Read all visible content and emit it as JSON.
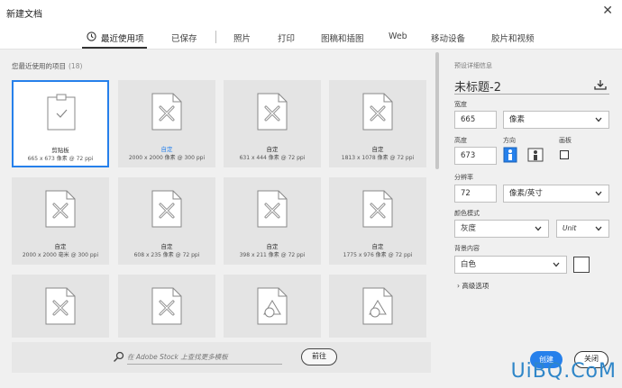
{
  "window": {
    "title": "新建文档"
  },
  "tabs": [
    {
      "label": "最近使用项"
    },
    {
      "label": "已保存"
    },
    {
      "label": "照片"
    },
    {
      "label": "打印"
    },
    {
      "label": "图稿和插图"
    },
    {
      "label": "Web"
    },
    {
      "label": "移动设备"
    },
    {
      "label": "胶片和视频"
    }
  ],
  "recent": {
    "title": "您最近使用的项目",
    "count": "(18)",
    "items": [
      {
        "name": "剪贴板",
        "dims": "665 x 673 像素 @ 72 ppi"
      },
      {
        "name": "自定",
        "dims": "2000 x 2000 像素 @ 300 ppi"
      },
      {
        "name": "自定",
        "dims": "631 x 444 像素 @ 72 ppi"
      },
      {
        "name": "自定",
        "dims": "1813 x 1078 像素 @ 72 ppi"
      },
      {
        "name": "自定",
        "dims": "2000 x 2000 毫米 @ 300 ppi"
      },
      {
        "name": "自定",
        "dims": "608 x 235 像素 @ 72 ppi"
      },
      {
        "name": "自定",
        "dims": "398 x 211 像素 @ 72 ppi"
      },
      {
        "name": "自定",
        "dims": "1775 x 976 像素 @ 72 ppi"
      }
    ]
  },
  "stock": {
    "placeholder": "在 Adobe Stock 上查找更多模板",
    "go_label": "前往"
  },
  "preset": {
    "section_label": "预设详细信息",
    "doc_name": "未标题-2",
    "width_label": "宽度",
    "width_value": "665",
    "width_unit": "像素",
    "height_label": "高度",
    "height_value": "673",
    "orientation_label": "方向",
    "artboard_label": "画板",
    "resolution_label": "分辨率",
    "resolution_value": "72",
    "resolution_unit": "像素/英寸",
    "color_mode_label": "颜色模式",
    "color_mode_value": "灰度",
    "bit_depth_value": "Unit",
    "bg_label": "背景内容",
    "bg_value": "白色",
    "advanced_label": "高级选项",
    "create_label": "创建",
    "close_label": "关闭"
  },
  "watermark": "UiBQ.CoM",
  "colors": {
    "accent": "#2680eb",
    "watermark": "#2f86c8"
  }
}
